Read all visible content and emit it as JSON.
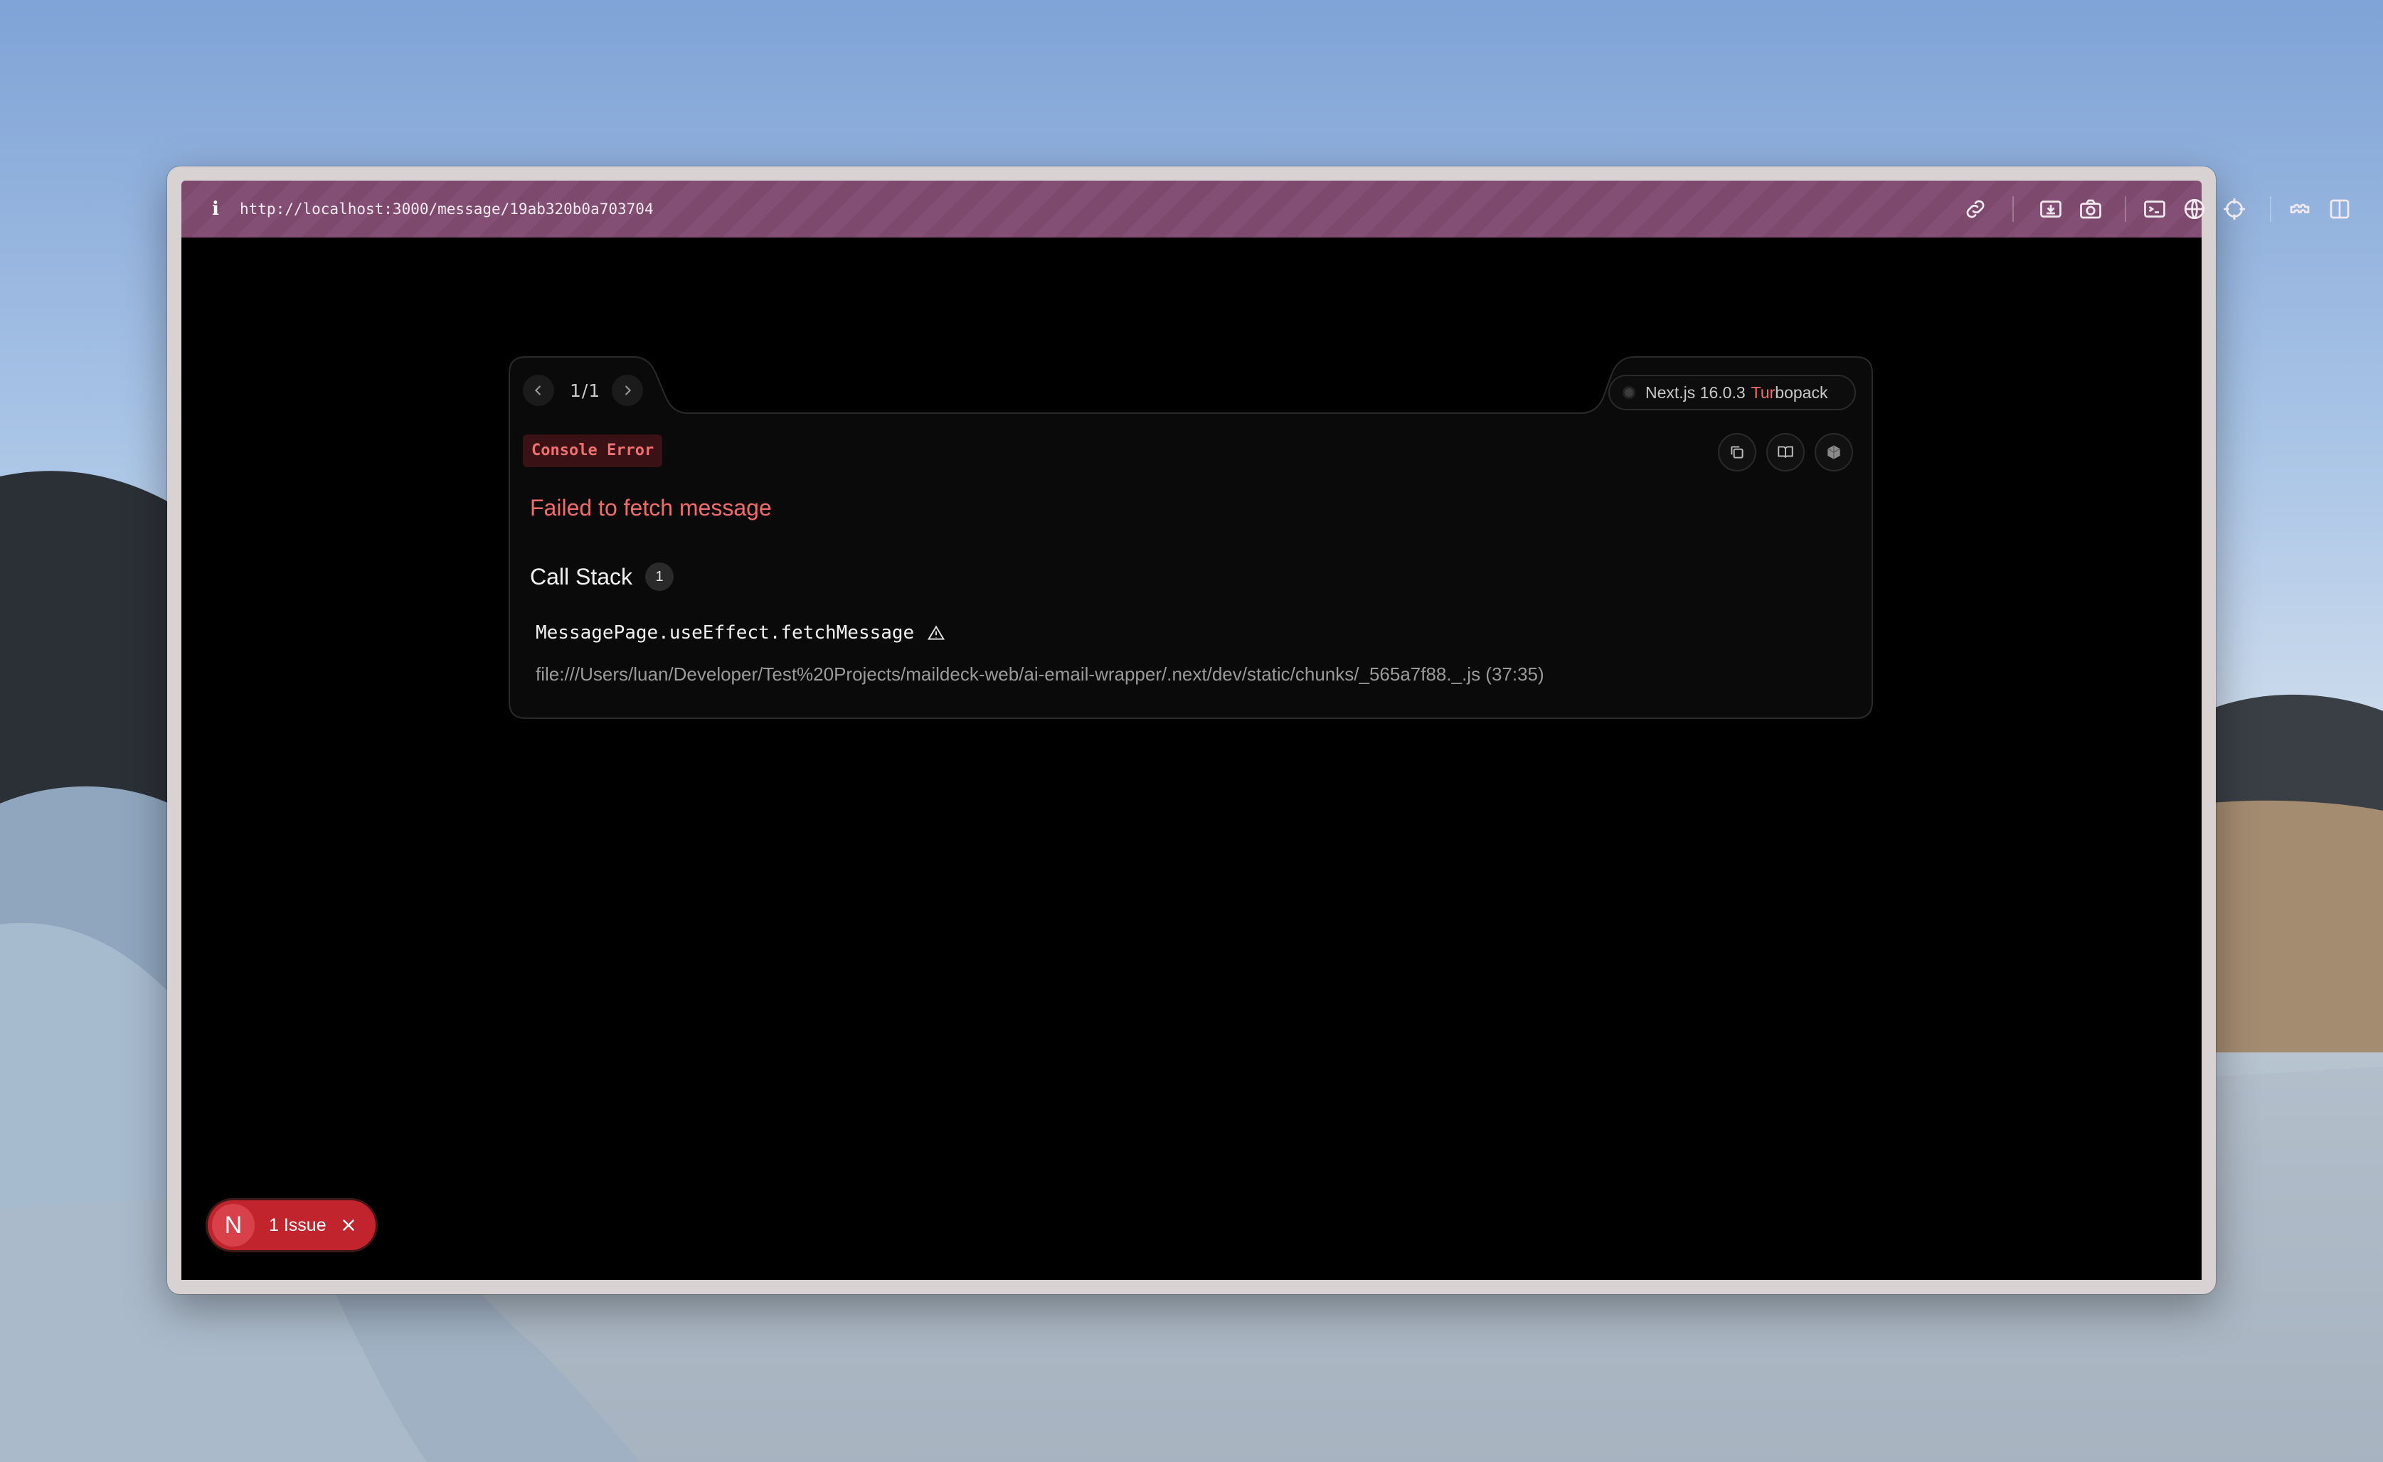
{
  "browser": {
    "url": "http://localhost:3000/message/19ab320b0a703704",
    "toolbar_icons": [
      "link-icon",
      "download-icon",
      "camera-icon",
      "terminal-icon",
      "globe-icon",
      "crosshair-icon",
      "extensions-icon",
      "sidebar-icon"
    ],
    "accent_color": "#7d4a6e"
  },
  "error_overlay": {
    "pager": {
      "count": "1/1"
    },
    "version": {
      "nextjs": "Next.js 16.0.3",
      "bundler_prefix": "Tur",
      "bundler_suffix": "bopack"
    },
    "badge": "Console Error",
    "actions": [
      "copy-icon",
      "docs-book-icon",
      "cube-icon"
    ],
    "message": "Failed to fetch message",
    "call_stack": {
      "label": "Call Stack",
      "count": "1",
      "frames": [
        {
          "function": "MessagePage.useEffect.fetchMessage",
          "file": "file:///Users/luan/Developer/Test%20Projects/maildeck-web/ai-email-wrapper/.next/dev/static/chunks/_565a7f88._.js (37:35)"
        }
      ]
    },
    "error_color": "#f26b6b"
  },
  "issues_indicator": {
    "logo_letter": "N",
    "label": "1 Issue",
    "color": "#c2242e"
  }
}
